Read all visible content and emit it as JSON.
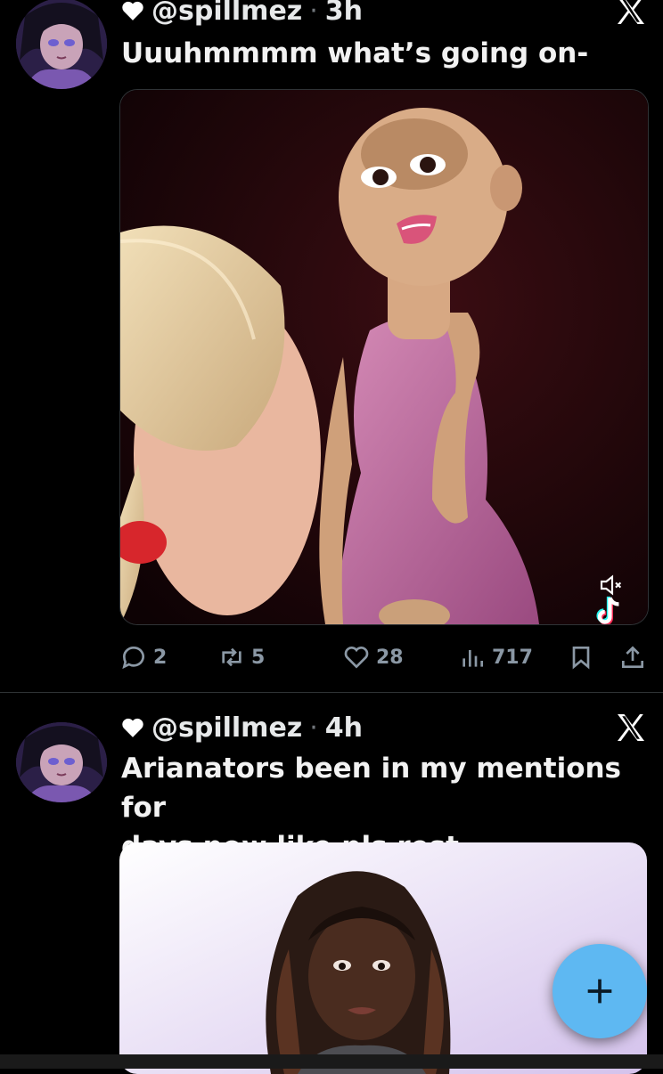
{
  "tweets": [
    {
      "handle": "@spillmez",
      "separator": "·",
      "time": "3h",
      "text": "Uuuhmmmm what’s going on-",
      "stats": {
        "replies": "2",
        "reposts": "5",
        "likes": "28",
        "views": "717"
      },
      "media": {
        "type": "video",
        "muted": true,
        "watermark": "tiktok"
      }
    },
    {
      "handle": "@spillmez",
      "separator": "·",
      "time": "4h",
      "text": "Arianators been in my mentions for\ndays now like pls rest",
      "media": {
        "type": "image"
      }
    }
  ],
  "icons": {
    "close": "x-logo-icon",
    "heart": "heart-icon",
    "reply": "reply-icon",
    "repost": "repost-icon",
    "like": "like-icon",
    "views": "views-icon",
    "bookmark": "bookmark-icon",
    "share": "share-icon",
    "compose": "plus-icon"
  },
  "colors": {
    "background": "#000000",
    "text": "#e7e9ea",
    "muted": "#71767b",
    "accent": "#5eb8f2"
  }
}
